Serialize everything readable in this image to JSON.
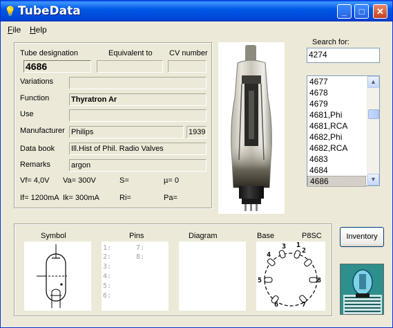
{
  "window": {
    "title": "TubeData",
    "buttons": {
      "minimize": "_",
      "maximize": "□",
      "close": "✕"
    }
  },
  "menu": [
    {
      "label": "File",
      "mnemonic": "F",
      "rest": "ile"
    },
    {
      "label": "Help",
      "mnemonic": "H",
      "rest": "elp"
    }
  ],
  "labels": {
    "tube_designation": "Tube designation",
    "equivalent_to": "Equivalent to",
    "cv_number": "CV number",
    "variations": "Variations",
    "function": "Function",
    "use": "Use",
    "manufacturer": "Manufacturer",
    "data_book": "Data book",
    "remarks": "Remarks",
    "search_for": "Search for:",
    "symbol": "Symbol",
    "pins": "Pins",
    "diagram": "Diagram",
    "base": "Base"
  },
  "fields": {
    "tube_designation": "4686",
    "equivalent_to": "",
    "cv_number": "",
    "variations": "",
    "function": "Thyratron Ar",
    "use": "",
    "manufacturer": "Philips",
    "year": "1939",
    "data_book": "Ill.Hist of Phil. Radio Valves",
    "remarks": "argon"
  },
  "params": {
    "vf": "Vf= 4,0V",
    "va": "Va= 300V",
    "s": "S=",
    "mu": "µ=   0",
    "if": "If= 1200mA",
    "ik": "Ik=  300mA",
    "ri": "Ri=",
    "pa": "Pa="
  },
  "search": {
    "value": "4274"
  },
  "list": {
    "items": [
      "4677",
      "4678",
      "4679",
      "4681,Phi",
      "4681,RCA",
      "4682,Phi",
      "4682,RCA",
      "4683",
      "4684",
      "4686"
    ],
    "selected": "4686"
  },
  "pins": [
    "1:",
    "2:",
    "3:",
    "4:",
    "5:",
    "6:",
    "7:",
    "8:"
  ],
  "base": {
    "code": "P8SC",
    "pin_numbers": [
      "1",
      "2",
      "3",
      "4",
      "5",
      "6",
      "7",
      "8"
    ]
  },
  "buttons": {
    "inventory": "Inventory"
  },
  "icons": [
    "bulb-icon",
    "minimize-icon",
    "maximize-icon",
    "close-icon",
    "scroll-up-icon",
    "scroll-down-icon"
  ]
}
